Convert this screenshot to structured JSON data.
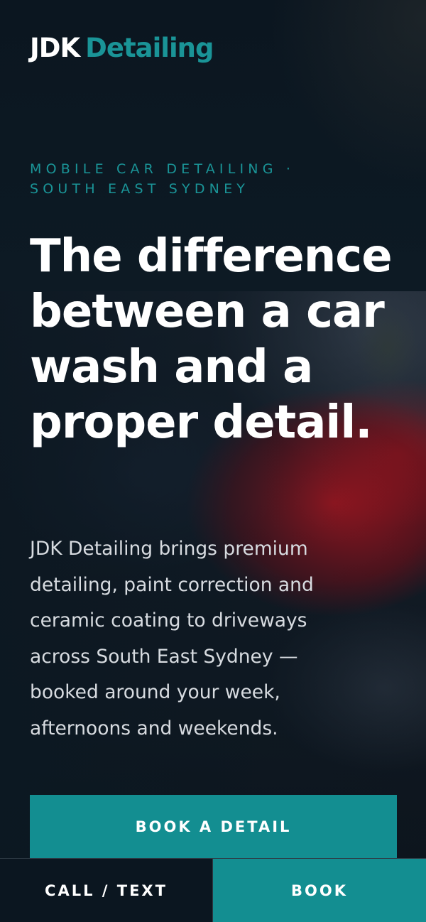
{
  "brand": {
    "name_primary": "JDK",
    "name_accent": "Detailing",
    "accent_color": "#1a9497"
  },
  "hero": {
    "eyebrow": "MOBILE CAR DETAILING · SOUTH EAST SYDNEY",
    "headline": "The difference between a car wash and a proper detail.",
    "lead": "JDK Detailing brings premium detailing, paint correction and ceramic coating to driveways across South East Sydney — booked around your week, afternoons and weekends.",
    "cta_label": "BOOK A DETAIL",
    "background_image": "car-photo"
  },
  "bottom_bar": {
    "call_label": "CALL / TEXT",
    "book_label": "BOOK"
  },
  "colors": {
    "background": "#0c1822",
    "button": "#138e91",
    "text": "#ffffff",
    "muted_text": "#d7dbe0"
  }
}
